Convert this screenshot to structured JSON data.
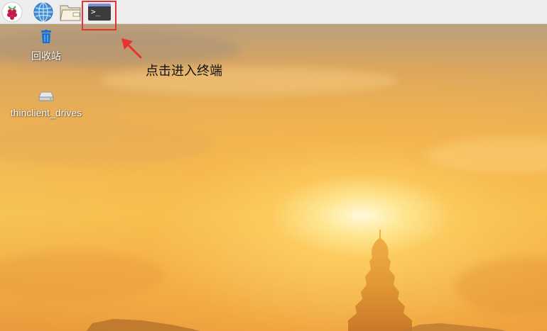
{
  "taskbar": {
    "items": [
      {
        "name": "raspberry-menu",
        "icon": "raspberry-pi-icon"
      },
      {
        "name": "web-browser",
        "icon": "globe-icon"
      },
      {
        "name": "file-manager",
        "icon": "folder-icon"
      },
      {
        "name": "terminal",
        "icon": "terminal-icon",
        "glyph": ">_"
      }
    ]
  },
  "desktop": {
    "icons": [
      {
        "label": "回收站",
        "icon": "trash-icon"
      },
      {
        "label": "thinclient_drives",
        "icon": "drive-icon"
      }
    ]
  },
  "annotation": {
    "text": "点击进入终端",
    "color": "#e8322f"
  },
  "colors": {
    "panel": "#ededed",
    "highlight": "#e8322f",
    "terminal_bg": "#3c3c3c",
    "terminal_bar": "#7a8fd6",
    "trash_blue": "#1a6fd1"
  }
}
